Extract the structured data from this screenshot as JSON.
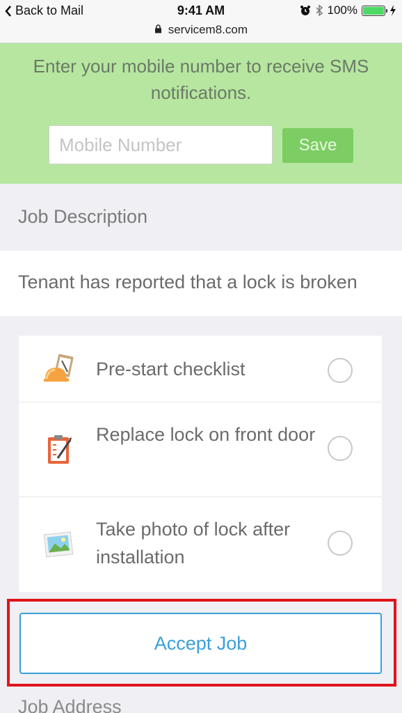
{
  "status_bar": {
    "back_label": "Back to Mail",
    "time": "9:41 AM",
    "battery": "100%",
    "battery_level": 1.0
  },
  "url_bar": {
    "url": "servicem8.com",
    "lock_icon": "lock-icon"
  },
  "sms_banner": {
    "message": "Enter your mobile number to receive SMS notifications.",
    "input_value": "",
    "input_placeholder": "Mobile Number",
    "save_label": "Save",
    "background_color": "#b7e6a0",
    "save_color": "#7ccd63"
  },
  "job_description": {
    "header": "Job Description",
    "text": "Tenant has reported that a lock is broken"
  },
  "checklist": {
    "items": [
      {
        "label": "Pre-start checklist",
        "icon": "hardhat-clipboard-icon",
        "checked": false
      },
      {
        "label": "Replace lock on front door",
        "icon": "clipboard-checklist-icon",
        "checked": false
      },
      {
        "label": "Take photo of lock after installation",
        "icon": "photo-icon",
        "checked": false
      }
    ]
  },
  "accept_job": {
    "label": "Accept Job",
    "color": "#3aa0d8",
    "highlight_color": "#e0141b"
  },
  "next_section": {
    "header": "Job Address"
  }
}
